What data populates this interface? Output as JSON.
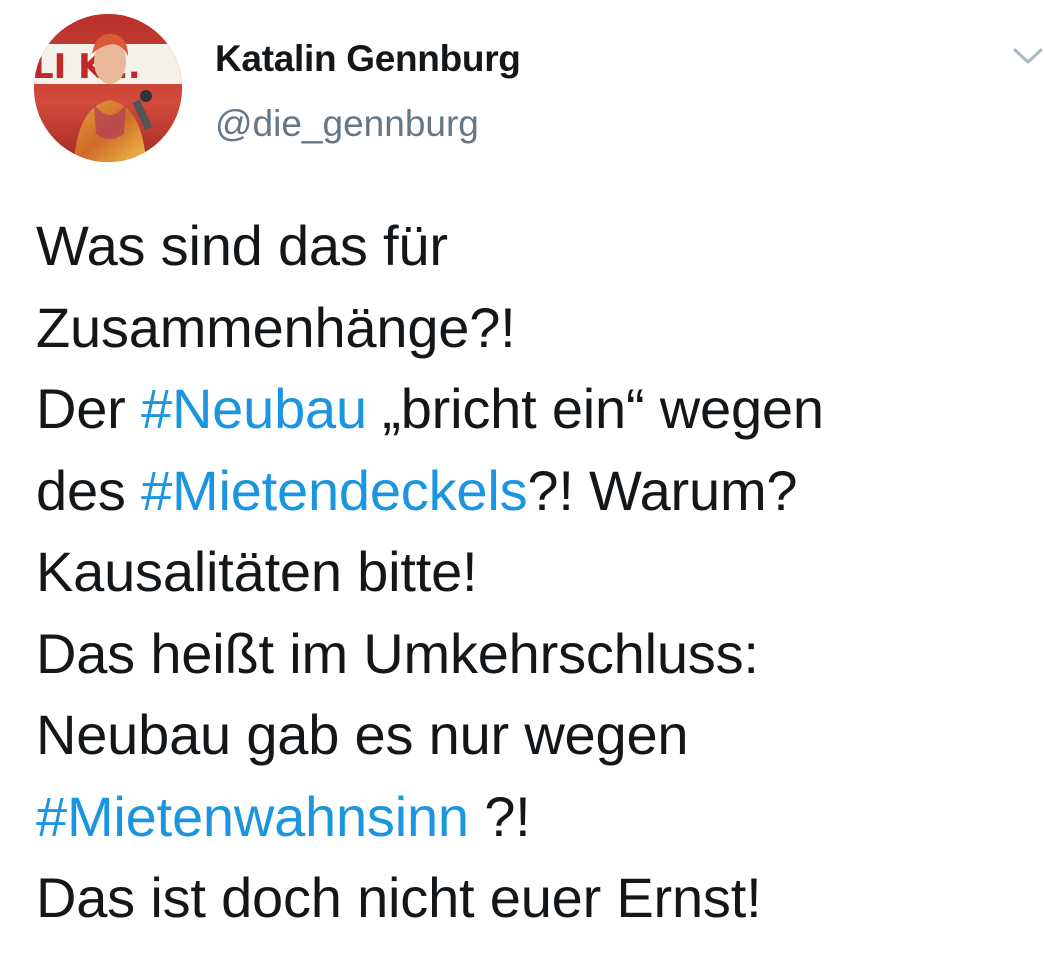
{
  "author": {
    "name": "Katalin Gennburg",
    "handle": "@die_gennburg",
    "avatar_banner_text": "LI KE."
  },
  "menu": {
    "icon": "chevron-down-icon"
  },
  "tweet": {
    "lines": [
      [
        {
          "t": "Was sind das für"
        }
      ],
      [
        {
          "t": "Zusammenhänge?!"
        }
      ],
      [
        {
          "t": "Der "
        },
        {
          "t": "#Neubau",
          "tag": true
        },
        {
          "t": " „bricht ein“ wegen"
        }
      ],
      [
        {
          "t": "des "
        },
        {
          "t": "#Mietendeckels",
          "tag": true
        },
        {
          "t": "?! Warum?"
        }
      ],
      [
        {
          "t": "Kausalitäten bitte!"
        }
      ],
      [
        {
          "t": "Das heißt im Umkehrschluss:"
        }
      ],
      [
        {
          "t": "Neubau gab es nur wegen"
        }
      ],
      [
        {
          "t": "#Mietenwahnsinn",
          "tag": true
        },
        {
          "t": " ?!"
        }
      ],
      [
        {
          "t": "Das ist doch nicht euer Ernst!"
        }
      ]
    ]
  },
  "colors": {
    "text": "#14171a",
    "secondary": "#657786",
    "link": "#1b95e0"
  }
}
